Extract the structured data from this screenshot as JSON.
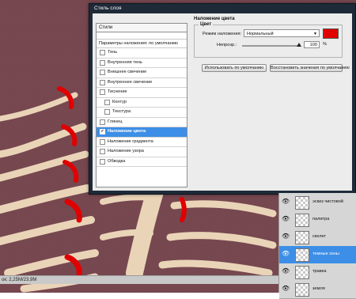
{
  "dialog": {
    "title": "Стиль слоя",
    "styles_header": "Стили",
    "blending_options": "Параметры наложения: по умолчанию",
    "items": [
      {
        "label": "Тень",
        "checked": false,
        "indent": false,
        "selected": false
      },
      {
        "label": "Внутренняя тень",
        "checked": false,
        "indent": false,
        "selected": false
      },
      {
        "label": "Внешнее свечение",
        "checked": false,
        "indent": false,
        "selected": false
      },
      {
        "label": "Внутреннее свечение",
        "checked": false,
        "indent": false,
        "selected": false
      },
      {
        "label": "Тиснение",
        "checked": false,
        "indent": false,
        "selected": false
      },
      {
        "label": "Контур",
        "checked": false,
        "indent": true,
        "selected": false
      },
      {
        "label": "Текстура",
        "checked": false,
        "indent": true,
        "selected": false
      },
      {
        "label": "Глянец",
        "checked": false,
        "indent": false,
        "selected": false
      },
      {
        "label": "Наложение цвета",
        "checked": true,
        "indent": false,
        "selected": true
      },
      {
        "label": "Наложение градиента",
        "checked": false,
        "indent": false,
        "selected": false
      },
      {
        "label": "Наложение узора",
        "checked": false,
        "indent": false,
        "selected": false
      },
      {
        "label": "Обводка",
        "checked": false,
        "indent": false,
        "selected": false
      }
    ],
    "section_title": "Наложение цвета",
    "color_legend": "Цвет",
    "blend_mode_label": "Режим наложения:",
    "blend_mode_value": "Нормальный",
    "overlay_color": "#e00000",
    "opacity_label": "Непрозр.:",
    "opacity_value": "100",
    "opacity_unit": "%",
    "button_default": "Использовать по умолчанию",
    "button_restore": "Восстановить значения по умолчанию"
  },
  "status": {
    "text": "ок: 2,25М/23,9М"
  },
  "layers": [
    {
      "name": "эскиз чистовой",
      "active": false
    },
    {
      "name": "палитра",
      "active": false
    },
    {
      "name": "скелет",
      "active": false
    },
    {
      "name": "темные зоны",
      "active": true
    },
    {
      "name": "травка",
      "active": false
    },
    {
      "name": "земля",
      "active": false
    }
  ],
  "colors": {
    "canvas_bg": "#7a4a52",
    "bone": "#ead4b8",
    "accent_red": "#e00000",
    "selection_blue": "#3d8ee6"
  }
}
